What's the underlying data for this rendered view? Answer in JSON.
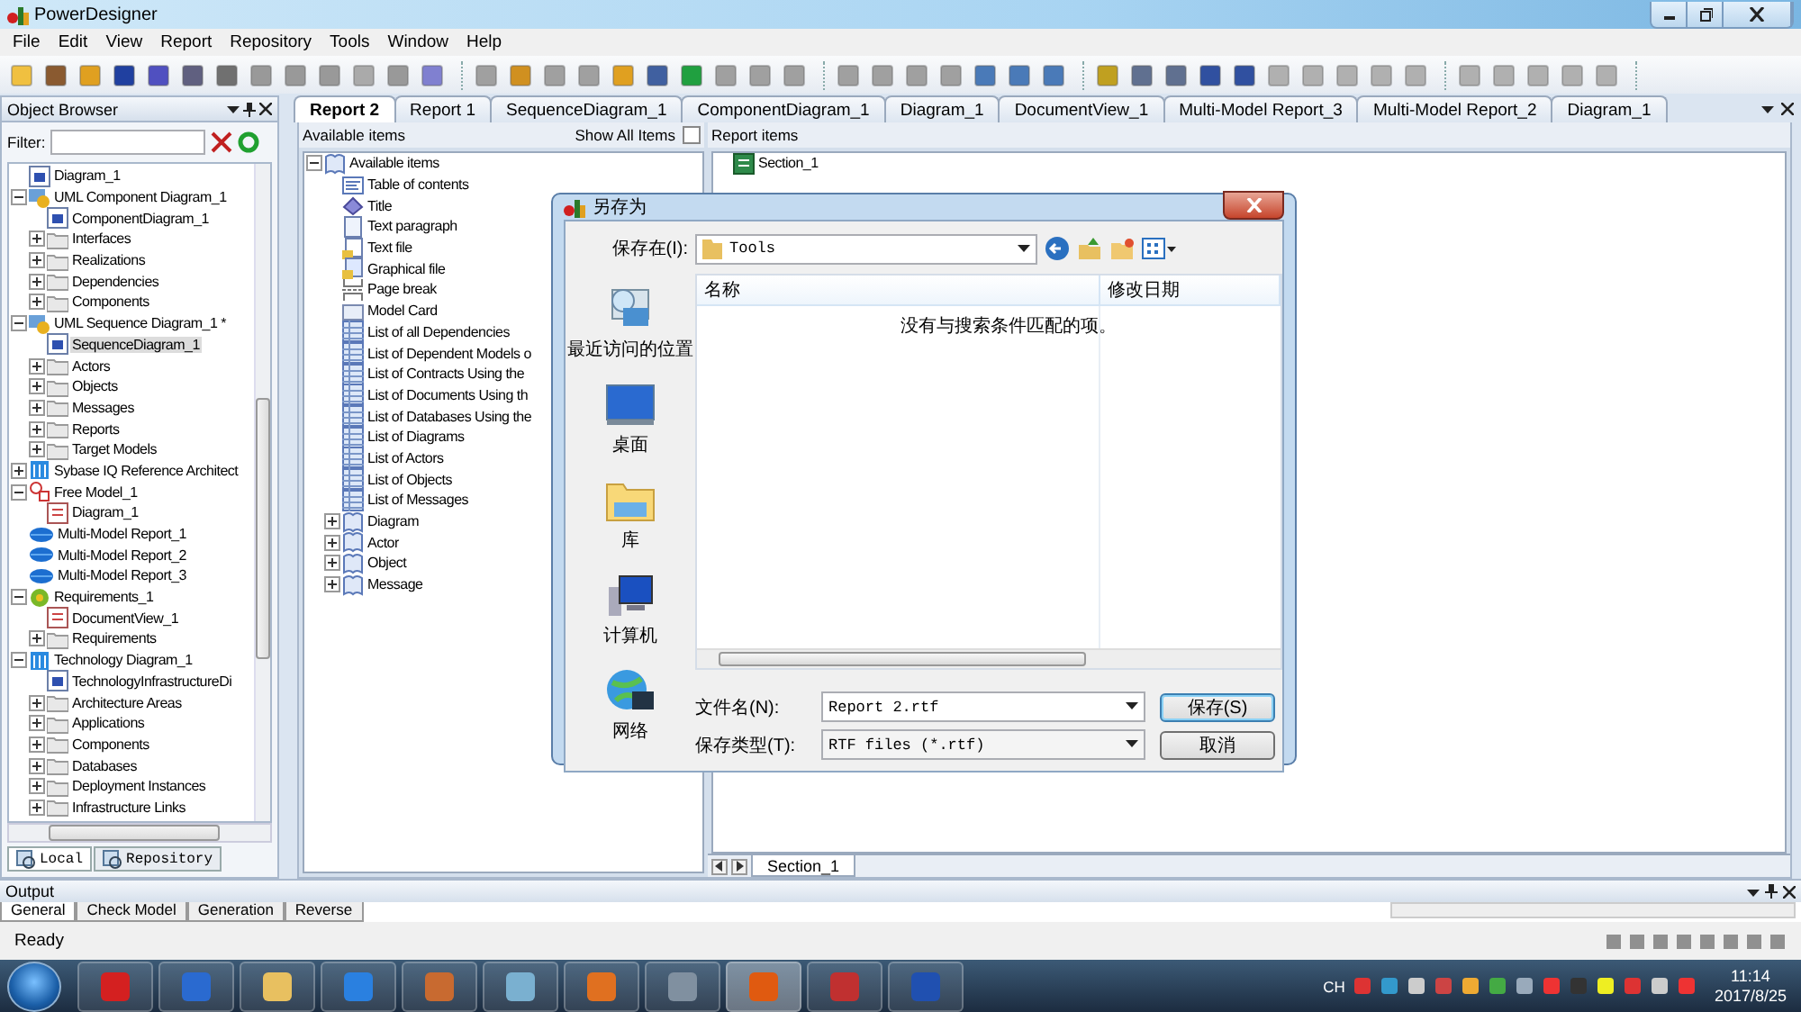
{
  "window": {
    "title": "PowerDesigner"
  },
  "menu": [
    "File",
    "Edit",
    "View",
    "Report",
    "Repository",
    "Tools",
    "Window",
    "Help"
  ],
  "object_browser": {
    "title": "Object Browser",
    "filter_label": "Filter:",
    "tree": [
      {
        "label": "Diagram_1",
        "kind": "diagram",
        "selected": false
      },
      {
        "label": "UML Component Diagram_1",
        "kind": "model",
        "expanded": true,
        "selected": false,
        "children": [
          {
            "label": "ComponentDiagram_1",
            "kind": "diagram",
            "selected": false
          },
          {
            "label": "Interfaces",
            "kind": "folder",
            "expanded": false,
            "selected": false
          },
          {
            "label": "Realizations",
            "kind": "folder",
            "expanded": false,
            "selected": false
          },
          {
            "label": "Dependencies",
            "kind": "folder",
            "expanded": false,
            "selected": false
          },
          {
            "label": "Components",
            "kind": "folder",
            "expanded": false,
            "selected": false
          }
        ]
      },
      {
        "label": "UML Sequence Diagram_1 *",
        "kind": "model",
        "expanded": true,
        "selected": false,
        "children": [
          {
            "label": "SequenceDiagram_1",
            "kind": "diagram",
            "selected": true
          },
          {
            "label": "Actors",
            "kind": "folder",
            "expanded": false,
            "selected": false
          },
          {
            "label": "Objects",
            "kind": "folder",
            "expanded": false,
            "selected": false
          },
          {
            "label": "Messages",
            "kind": "folder",
            "expanded": false,
            "selected": false
          },
          {
            "label": "Reports",
            "kind": "folder",
            "expanded": false,
            "selected": false
          },
          {
            "label": "Target Models",
            "kind": "folder",
            "expanded": false,
            "selected": false
          }
        ]
      },
      {
        "label": "Sybase IQ Reference Architect",
        "kind": "architecture",
        "expanded": false,
        "selected": false
      },
      {
        "label": "Free Model_1",
        "kind": "free-model",
        "expanded": true,
        "selected": false,
        "children": [
          {
            "label": "Diagram_1",
            "kind": "free-diagram",
            "selected": false
          }
        ]
      },
      {
        "label": "Multi-Model Report_1",
        "kind": "report",
        "selected": false
      },
      {
        "label": "Multi-Model Report_2",
        "kind": "report",
        "selected": false
      },
      {
        "label": "Multi-Model Report_3",
        "kind": "report",
        "selected": false
      },
      {
        "label": "Requirements_1",
        "kind": "requirements",
        "expanded": true,
        "selected": false,
        "children": [
          {
            "label": "DocumentView_1",
            "kind": "document-view",
            "selected": false
          },
          {
            "label": "Requirements",
            "kind": "folder",
            "expanded": false,
            "selected": false
          }
        ]
      },
      {
        "label": "Technology Diagram_1",
        "kind": "architecture",
        "expanded": true,
        "selected": false,
        "children": [
          {
            "label": "TechnologyInfrastructureDi",
            "kind": "diagram",
            "selected": false
          },
          {
            "label": "Architecture Areas",
            "kind": "folder",
            "expanded": false,
            "selected": false
          },
          {
            "label": "Applications",
            "kind": "folder",
            "expanded": false,
            "selected": false
          },
          {
            "label": "Components",
            "kind": "folder",
            "expanded": false,
            "selected": false
          },
          {
            "label": "Databases",
            "kind": "folder",
            "expanded": false,
            "selected": false
          },
          {
            "label": "Deployment Instances",
            "kind": "folder",
            "expanded": false,
            "selected": false
          },
          {
            "label": "Infrastructure Links",
            "kind": "folder",
            "expanded": false,
            "selected": false
          }
        ]
      }
    ],
    "tabs": [
      {
        "label": "Local",
        "selected": true
      },
      {
        "label": "Repository",
        "selected": false
      }
    ]
  },
  "tabs": [
    {
      "label": "Report 2",
      "selected": true
    },
    {
      "label": "Report 1",
      "selected": false
    },
    {
      "label": "SequenceDiagram_1",
      "selected": false
    },
    {
      "label": "ComponentDiagram_1",
      "selected": false
    },
    {
      "label": "Diagram_1",
      "selected": false
    },
    {
      "label": "DocumentView_1",
      "selected": false
    },
    {
      "label": "Multi-Model Report_3",
      "selected": false
    },
    {
      "label": "Multi-Model Report_2",
      "selected": false
    },
    {
      "label": "Diagram_1",
      "selected": false
    }
  ],
  "available_items": {
    "title": "Available items",
    "show_all_label": "Show All Items",
    "show_all_checked": false,
    "tree": [
      {
        "label": "Available items",
        "kind": "book",
        "expanded": true,
        "children": [
          {
            "label": "Table of contents",
            "kind": "toc"
          },
          {
            "label": "Title",
            "kind": "title"
          },
          {
            "label": "Text paragraph",
            "kind": "page"
          },
          {
            "label": "Text file",
            "kind": "text-file"
          },
          {
            "label": "Graphical file",
            "kind": "graphic-file"
          },
          {
            "label": "Page break",
            "kind": "page-break"
          },
          {
            "label": "Model Card",
            "kind": "card"
          },
          {
            "label": "List of all Dependencies",
            "kind": "list"
          },
          {
            "label": "List of Dependent Models o",
            "kind": "list"
          },
          {
            "label": "List of Contracts Using the",
            "kind": "list"
          },
          {
            "label": "List of Documents Using th",
            "kind": "list"
          },
          {
            "label": "List of Databases Using the",
            "kind": "list"
          },
          {
            "label": "List of Diagrams",
            "kind": "list"
          },
          {
            "label": "List of Actors",
            "kind": "list"
          },
          {
            "label": "List of Objects",
            "kind": "list"
          },
          {
            "label": "List of Messages",
            "kind": "list"
          },
          {
            "label": "Diagram",
            "kind": "book",
            "expanded": false
          },
          {
            "label": "Actor",
            "kind": "book",
            "expanded": false
          },
          {
            "label": "Object",
            "kind": "book",
            "expanded": false
          },
          {
            "label": "Message",
            "kind": "book",
            "expanded": false
          }
        ]
      }
    ]
  },
  "report_items": {
    "title": "Report items",
    "tree": [
      {
        "label": "Section_1",
        "kind": "section"
      }
    ],
    "section_tabs": [
      {
        "label": "Section_1",
        "selected": true
      }
    ]
  },
  "dialog": {
    "title": "另存为",
    "save_in_label": "保存在(I):",
    "save_in_value": "Tools",
    "places": [
      {
        "label": "最近访问的位置",
        "kind": "recent"
      },
      {
        "label": "桌面",
        "kind": "desktop"
      },
      {
        "label": "库",
        "kind": "library"
      },
      {
        "label": "计算机",
        "kind": "computer"
      },
      {
        "label": "网络",
        "kind": "network"
      }
    ],
    "columns": [
      "名称",
      "修改日期"
    ],
    "empty_message": "没有与搜索条件匹配的项。",
    "file_name_label": "文件名(N):",
    "file_name": "Report 2.rtf",
    "file_type_label": "保存类型(T):",
    "file_type": "RTF files (*.rtf)",
    "buttons": [
      {
        "label": "保存(S)",
        "default": true
      },
      {
        "label": "取消",
        "default": false
      }
    ]
  },
  "output": {
    "title": "Output",
    "tabs": [
      {
        "label": "General",
        "selected": true
      },
      {
        "label": "Check Model",
        "selected": false
      },
      {
        "label": "Generation",
        "selected": false
      },
      {
        "label": "Reverse",
        "selected": false
      }
    ]
  },
  "status_bar": {
    "text": "Ready"
  },
  "taskbar": {
    "input_indicator": "CH",
    "time": "11:14",
    "date": "2017/8/25"
  }
}
